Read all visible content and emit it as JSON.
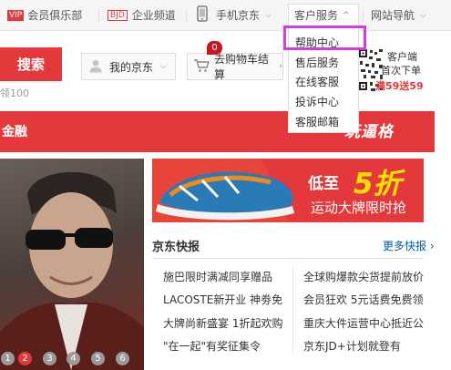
{
  "topbar": {
    "vip_tag": "VIP",
    "vip_label": "会员俱乐部",
    "bjd_tag": "BJD",
    "bjd_label": "企业频道",
    "mobile_label": "手机京东",
    "service_label": "客户服务",
    "sitenav_label": "网站导航"
  },
  "service_menu": {
    "items": [
      "帮助中心",
      "售后服务",
      "在线客服",
      "投诉中心",
      "客服邮箱"
    ]
  },
  "search": {
    "button_label": "搜索",
    "hint": "领100"
  },
  "my_jd": {
    "label": "我的京东"
  },
  "cart": {
    "label": "去购物车结算",
    "count": "0"
  },
  "client": {
    "line1": "客户端",
    "line2": "首次下单",
    "line3": "满59送59"
  },
  "rednav": {
    "finance_label": "金融",
    "promo_label": "玩逼格"
  },
  "ad": {
    "line1": "低至",
    "big": "5折",
    "line2": "运动大牌限时抢"
  },
  "carousel": {
    "pages": [
      "1",
      "2",
      "3",
      "4",
      "5",
      "6"
    ],
    "active_page": "2"
  },
  "news": {
    "title": "京东快报",
    "more": "更多快报 ›",
    "items_left": [
      "施巴限时满减同享赠品",
      "LACOSTE新开业 神劵免",
      "大牌尚新盛宴 1折起欢购",
      "\"在一起\"有奖征集令"
    ],
    "items_right": [
      "全球购爆款尖货提前放价",
      "会员狂欢 5元话费免费领",
      "重庆大件运营中心抵近公",
      "京东JD+计划就登有"
    ]
  },
  "colors": {
    "brand_red": "#e4393c",
    "highlight": "#d23ddb",
    "link_blue": "#005ea7"
  }
}
